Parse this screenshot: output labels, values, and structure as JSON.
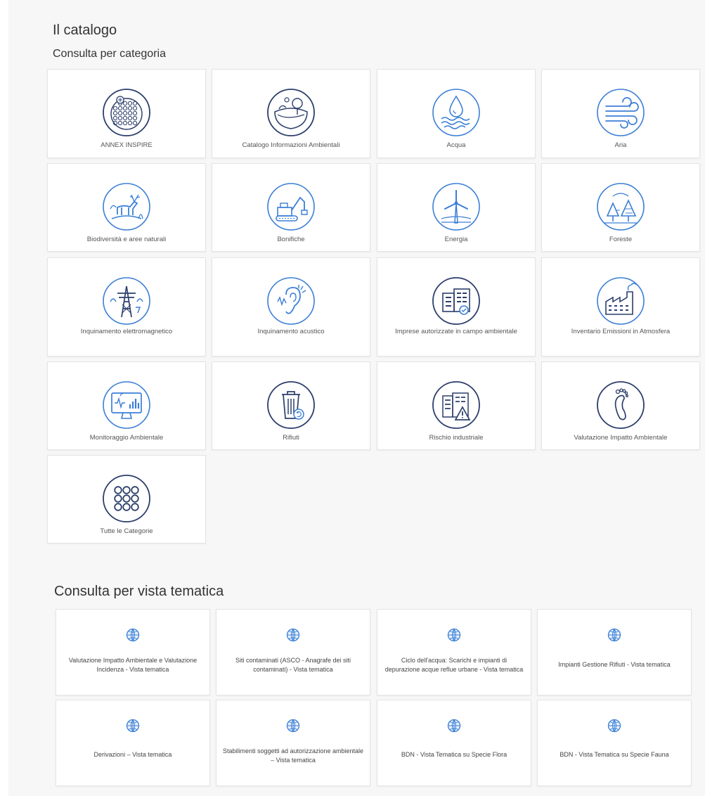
{
  "page": {
    "title": "Il catalogo",
    "categories_heading": "Consulta per categoria",
    "themes_heading": "Consulta per vista tematica"
  },
  "colors": {
    "icon_blue": "#3b7fd6",
    "icon_dark": "#2c3e6b",
    "card_border": "#e4e4e4",
    "background": "#f7f7f7"
  },
  "categories": [
    {
      "label": "ANNEX INSPIRE",
      "icon": "inspire-icon"
    },
    {
      "label": "Catalogo Informazioni Ambientali",
      "icon": "landscape-icon"
    },
    {
      "label": "Acqua",
      "icon": "water-drop-icon"
    },
    {
      "label": "Aria",
      "icon": "wind-icon"
    },
    {
      "label": "Biodiversità e aree naturali",
      "icon": "deer-icon"
    },
    {
      "label": "Bonifiche",
      "icon": "excavator-icon"
    },
    {
      "label": "Energia",
      "icon": "wind-turbine-icon"
    },
    {
      "label": "Foreste",
      "icon": "forest-icon"
    },
    {
      "label": "Inquinamento elettromagnetico",
      "icon": "power-tower-icon"
    },
    {
      "label": "Inquinamento acustico",
      "icon": "ear-sound-icon"
    },
    {
      "label": "Imprese autorizzate in campo ambientale",
      "icon": "buildings-icon"
    },
    {
      "label": "Inventario Emissioni in Atmosfera",
      "icon": "factory-icon"
    },
    {
      "label": "Monitoraggio Ambientale",
      "icon": "monitor-chart-icon"
    },
    {
      "label": "Rifiuti",
      "icon": "trash-bin-icon"
    },
    {
      "label": "Rischio industriale",
      "icon": "warning-building-icon"
    },
    {
      "label": "Valutazione Impatto Ambientale",
      "icon": "footprint-icon"
    },
    {
      "label": "Tutte le Categorie",
      "icon": "grid-dots-icon"
    }
  ],
  "themes": [
    {
      "label": "Valutazione Impatto Ambientale e Valutazione Incidenza - Vista tematica",
      "icon": "globe-icon"
    },
    {
      "label": "Siti contaminati (ASCO - Anagrafe dei siti contaminati) - Vista tematica",
      "icon": "globe-icon"
    },
    {
      "label": "Ciclo dell'acqua: Scarichi e impianti di depurazione acque reflue urbane - Vista tematica",
      "icon": "globe-icon"
    },
    {
      "label": "Impianti Gestione Rifiuti - Vista tematica",
      "icon": "globe-icon"
    },
    {
      "label": "Derivazioni – Vista tematica",
      "icon": "globe-icon"
    },
    {
      "label": "Stabilimenti soggetti ad autorizzazione ambientale – Vista tematica",
      "icon": "globe-icon"
    },
    {
      "label": "BDN - Vista Tematica su Specie Flora",
      "icon": "globe-icon"
    },
    {
      "label": "BDN - Vista Tematica su Specie Fauna",
      "icon": "globe-icon"
    }
  ]
}
